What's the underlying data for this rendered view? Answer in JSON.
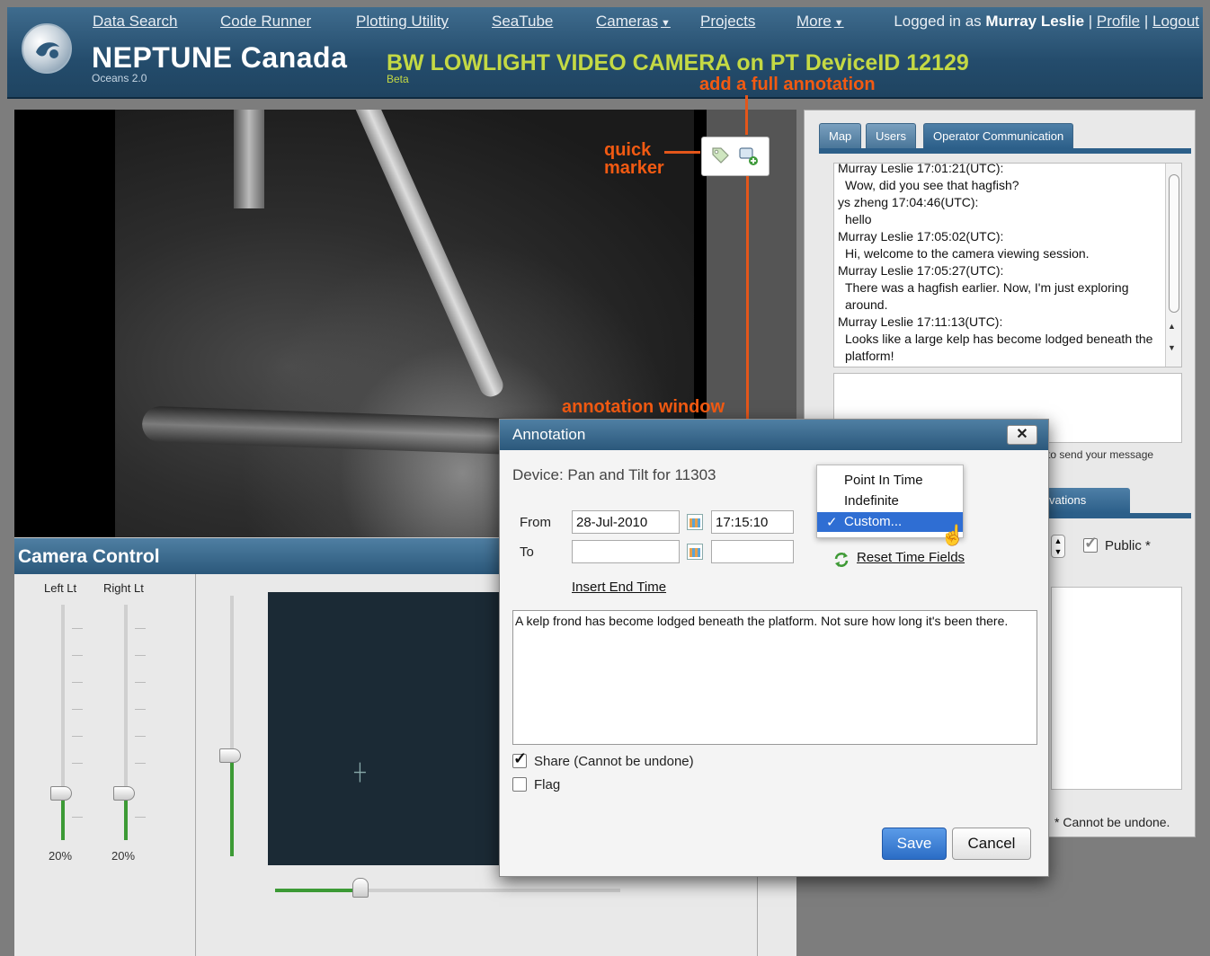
{
  "header": {
    "brand": "NEPTUNE Canada",
    "brand_sub": "Oceans 2.0",
    "title": "BW LOWLIGHT VIDEO CAMERA on PT DeviceID 12129",
    "title_sub": "Beta",
    "nav": {
      "data_search": "Data Search",
      "code_runner": "Code Runner",
      "plotting_utility": "Plotting Utility",
      "seatube": "SeaTube",
      "cameras": "Cameras",
      "projects": "Projects",
      "more": "More"
    },
    "login": {
      "prefix": "Logged in as",
      "user": "Murray Leslie",
      "profile": "Profile",
      "logout": "Logout",
      "sep": "|"
    }
  },
  "annotations": {
    "quick_marker_line1": "quick",
    "quick_marker_line2": "marker",
    "full_annotation": "add a full annotation",
    "annotation_window": "annotation window"
  },
  "camera_control": {
    "title": "Camera Control",
    "left_light_label": "Left Lt",
    "right_light_label": "Right Lt",
    "left_light_value": "20%",
    "right_light_value": "20%",
    "left_light_level": 0.2,
    "right_light_level": 0.2
  },
  "right_panel": {
    "tabs": {
      "map": "Map",
      "users": "Users",
      "operator": "Operator Communication"
    },
    "chat": [
      {
        "header": "Murray Leslie 17:01:21(UTC):",
        "text": "Wow, did you see that hagfish?"
      },
      {
        "header": "ys zheng 17:04:46(UTC):",
        "text": "hello"
      },
      {
        "header": "Murray Leslie 17:05:02(UTC):",
        "text": "Hi, welcome to the camera viewing session."
      },
      {
        "header": "Murray Leslie 17:05:27(UTC):",
        "text": "There was a hagfish earlier. Now, I'm just exploring around."
      },
      {
        "header": "Murray Leslie 17:11:13(UTC):",
        "text": "Looks like a large kelp has become lodged beneath the platform!"
      }
    ],
    "send_hint": "to send your message",
    "observations_tab": "vations",
    "public_label": "Public *",
    "undo_note": "* Cannot be undone."
  },
  "modal": {
    "title": "Annotation",
    "close": "✕",
    "device": "Device: Pan and Tilt for 11303",
    "from_label": "From",
    "to_label": "To",
    "from_date": "28-Jul-2010",
    "from_time": "17:15:10",
    "to_date": "",
    "to_time": "",
    "insert_end_time": "Insert End Time",
    "reset_time_fields": "Reset Time Fields",
    "dropdown": {
      "point_in_time": "Point In Time",
      "indefinite": "Indefinite",
      "custom": "Custom...",
      "check": "✓"
    },
    "comment": "A kelp frond has become lodged beneath the platform. Not sure how long it's been there.",
    "share_label": "Share (Cannot be undone)",
    "flag_label": "Flag",
    "save": "Save",
    "cancel": "Cancel"
  },
  "colors": {
    "accent_orange": "#f25a12",
    "title_green": "#c4d944",
    "header_blue": "#244c6c",
    "save_blue": "#2b6dc6"
  }
}
